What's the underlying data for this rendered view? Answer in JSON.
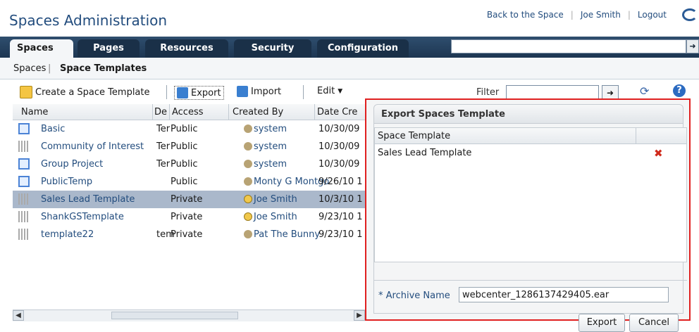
{
  "header": {
    "app_title": "Spaces Administration",
    "links": [
      "Back to the Space",
      "Joe Smith",
      "Logout"
    ]
  },
  "tabs": [
    {
      "label": "Spaces",
      "selected": true
    },
    {
      "label": "Pages",
      "selected": false
    },
    {
      "label": "Resources",
      "selected": false
    },
    {
      "label": "Security",
      "selected": false
    },
    {
      "label": "Configuration",
      "selected": false
    }
  ],
  "breadcrumb": {
    "parent": "Spaces",
    "current": "Space Templates"
  },
  "toolbar": {
    "create_label": "Create a Space Template",
    "export_label": "Export",
    "import_label": "Import",
    "edit_label": "Edit",
    "filter_label": "Filter"
  },
  "table": {
    "columns": [
      "Name",
      "Description",
      "Access",
      "Created By",
      "Date Created"
    ],
    "column_display": [
      "Name",
      "De",
      "Access",
      "Created By",
      "Date Cre"
    ],
    "rows": [
      {
        "name": "Basic",
        "desc": "Ter",
        "access": "Public",
        "creator": "system",
        "date": "10/30/09",
        "icon": "blue",
        "user_icon": "group"
      },
      {
        "name": "Community of Interest",
        "desc": "Ter",
        "access": "Public",
        "creator": "system",
        "date": "10/30/09",
        "icon": "gray",
        "user_icon": "group"
      },
      {
        "name": "Group Project",
        "desc": "Ter",
        "access": "Public",
        "creator": "system",
        "date": "10/30/09",
        "icon": "blue",
        "user_icon": "group"
      },
      {
        "name": "PublicTemp",
        "desc": "",
        "access": "Public",
        "creator": "Monty G Montgo",
        "date": "9/26/10 1",
        "icon": "blue",
        "user_icon": "group"
      },
      {
        "name": "Sales Lead Template",
        "desc": "",
        "access": "Private",
        "creator": "Joe Smith",
        "date": "10/3/10 1",
        "icon": "gray",
        "user_icon": "face",
        "selected": true
      },
      {
        "name": "ShankGSTemplate",
        "desc": "",
        "access": "Private",
        "creator": "Joe Smith",
        "date": "9/23/10 1",
        "icon": "gray",
        "user_icon": "face"
      },
      {
        "name": "template22",
        "desc": "tem",
        "access": "Private",
        "creator": "Pat The Bunny",
        "date": "9/23/10 1",
        "icon": "gray",
        "user_icon": "group"
      }
    ]
  },
  "dialog": {
    "title": "Export Spaces Template",
    "column_header": "Space Template",
    "items": [
      "Sales Lead Template"
    ],
    "archive_label": "Archive Name",
    "archive_required_mark": "*",
    "archive_value": "webcenter_1286137429405.ear",
    "export_button": "Export",
    "cancel_button": "Cancel"
  },
  "colors": {
    "accent": "#234d7e",
    "tabbar": "#1d3652",
    "highlight_border": "#e02020",
    "selected_row": "#aab8cb"
  }
}
